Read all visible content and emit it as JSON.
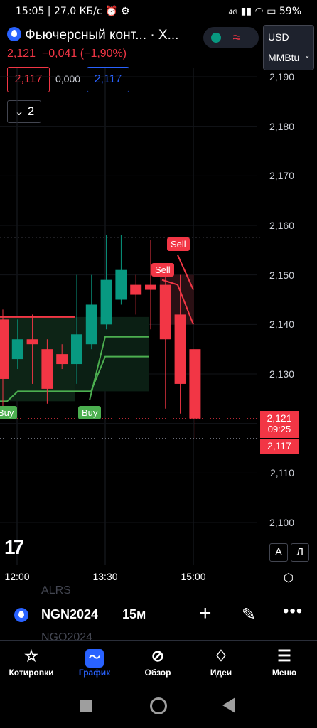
{
  "status_bar": {
    "time": "15:05",
    "speed": "27,0 КБ/с",
    "network": "4G",
    "battery": "59%"
  },
  "header": {
    "title": "Фьючерсный конт... · X...",
    "last_price": "2,121",
    "change": "−0,041 (−1,90%)",
    "bid": "2,117",
    "spread": "0,000",
    "ask": "2,117",
    "stack_count": "2",
    "currency": "USD",
    "unit": "MMBtu"
  },
  "chart_data": {
    "type": "candlestick",
    "y_ticks": [
      "2,190",
      "2,180",
      "2,170",
      "2,160",
      "2,150",
      "2,140",
      "2,130",
      "2,120",
      "2,110",
      "2,100"
    ],
    "y_tick_values": [
      2.19,
      2.18,
      2.17,
      2.16,
      2.15,
      2.14,
      2.13,
      2.12,
      2.11,
      2.1
    ],
    "x_ticks": [
      "12:00",
      "13:30",
      "15:00"
    ],
    "last_price_tag": "2,121",
    "countdown": "09:25",
    "bid_tag": "2,117",
    "signals": [
      {
        "label": "Buy",
        "type": "buy"
      },
      {
        "label": "Buy",
        "type": "buy"
      },
      {
        "label": "Sell",
        "type": "sell"
      },
      {
        "label": "Sell",
        "type": "sell"
      }
    ],
    "candles": [
      {
        "o": 2.141,
        "h": 2.143,
        "l": 2.122,
        "c": 2.129
      },
      {
        "o": 2.133,
        "h": 2.141,
        "l": 2.131,
        "c": 2.137
      },
      {
        "o": 2.137,
        "h": 2.142,
        "l": 2.128,
        "c": 2.136
      },
      {
        "o": 2.135,
        "h": 2.137,
        "l": 2.124,
        "c": 2.127
      },
      {
        "o": 2.134,
        "h": 2.136,
        "l": 2.131,
        "c": 2.132
      },
      {
        "o": 2.132,
        "h": 2.15,
        "l": 2.128,
        "c": 2.138
      },
      {
        "o": 2.136,
        "h": 2.15,
        "l": 2.135,
        "c": 2.144
      },
      {
        "o": 2.14,
        "h": 2.158,
        "l": 2.139,
        "c": 2.149
      },
      {
        "o": 2.145,
        "h": 2.158,
        "l": 2.144,
        "c": 2.151
      },
      {
        "o": 2.148,
        "h": 2.15,
        "l": 2.142,
        "c": 2.146
      },
      {
        "o": 2.148,
        "h": 2.157,
        "l": 2.139,
        "c": 2.147
      },
      {
        "o": 2.148,
        "h": 2.15,
        "l": 2.123,
        "c": 2.137
      },
      {
        "o": 2.142,
        "h": 2.15,
        "l": 2.122,
        "c": 2.128
      },
      {
        "o": 2.135,
        "h": 2.135,
        "l": 2.117,
        "c": 2.121
      }
    ],
    "buttons": {
      "auto": "A",
      "log": "Л"
    }
  },
  "symbol_bar": {
    "symbol": "NGN2024",
    "interval": "15м",
    "prev_hint": "ALRS",
    "next_hint": "NGQ2024"
  },
  "bottom_nav": [
    {
      "label": "Котировки",
      "icon": "star-icon"
    },
    {
      "label": "График",
      "icon": "chart-icon"
    },
    {
      "label": "Обзор",
      "icon": "compass-icon"
    },
    {
      "label": "Идеи",
      "icon": "lightbulb-icon"
    },
    {
      "label": "Меню",
      "icon": "menu-icon"
    }
  ],
  "colors": {
    "up": "#089981",
    "down": "#f23645",
    "accent": "#2962ff"
  }
}
